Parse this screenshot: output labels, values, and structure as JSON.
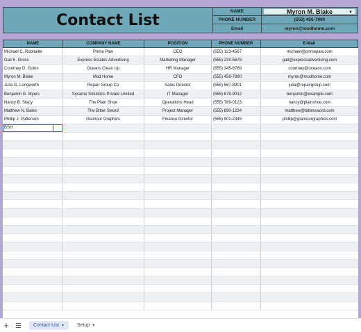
{
  "header": {
    "title": "Contact List",
    "labels": {
      "name": "NAME",
      "phone": "PHONE NUMBER",
      "email": "Email"
    },
    "selected_name": "Myron M. Blake",
    "phone": "(555) 456-7890",
    "email": "myron@modhome.com"
  },
  "table": {
    "columns": [
      "NAME",
      "COMPANY NAME",
      "POSITION",
      "PHONE NUMBER",
      "E-Mail"
    ],
    "rows": [
      [
        "Michael C. Robitaille",
        "Prime Paw",
        "CEO",
        "(555) 123-4567",
        "michael@primepaw.com"
      ],
      [
        "Gail K. Gross",
        "Express Estates Advertising",
        "Marketing Manager",
        "(555) 234-5678",
        "gail@expressadvertising.com"
      ],
      [
        "Courtney D. Guinn",
        "Oceans Clean Up",
        "HR Manager",
        "(555) 345-6789",
        "courtney@oceans.com"
      ],
      [
        "Myron M. Blake",
        "Mod Home",
        "CFO",
        "(555) 456-7890",
        "myron@modhome.com"
      ],
      [
        "Julia G. Longworth",
        "Repair Group Co",
        "Sales Director",
        "(555) 567-8901",
        "julia@repairgroup.com"
      ],
      [
        "Benjamin G. Myers",
        "Sysame Solutions Private Limited",
        "IT Manager",
        "(555) 678-9012",
        "benjamin@example.com"
      ],
      [
        "Nancy B. Stacy",
        "The Plain Shoe",
        "Operations Head",
        "(555) 789-0123",
        "nancy@plainshoe.com"
      ],
      [
        "Matthew N. Bales",
        "The Bitter Sword",
        "Project Manager",
        "(555) 890-1234",
        "matthew@bittersword.com"
      ],
      [
        "Phillip J. Patterson",
        "Glamour Graphics",
        "Finance Director",
        "(555) 901-2345",
        "phillip@glamourgraphics.com"
      ]
    ],
    "active_cell_value": "BSH"
  },
  "sheets": {
    "tabs": [
      {
        "label": "Contact List",
        "active": true
      },
      {
        "label": "Setup",
        "active": false
      }
    ]
  },
  "colors": {
    "background": "#b4a7d6",
    "header_fill": "#6fa8b8",
    "active_tab": "#1a4fb3"
  },
  "icons": [
    "add-sheet-icon",
    "all-sheets-menu-icon",
    "chevron-down-icon"
  ]
}
